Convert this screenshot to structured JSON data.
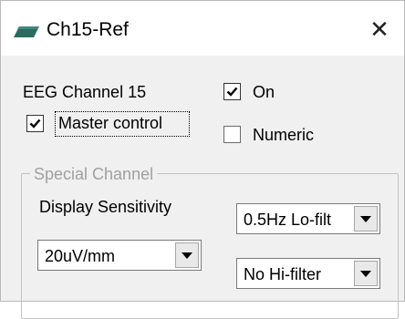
{
  "window": {
    "title": "Ch15-Ref",
    "close_glyph": "✕",
    "icon": "eeg-device-icon"
  },
  "main": {
    "channel_label": "EEG Channel 15",
    "on_checkbox": {
      "label": "On",
      "checked": true
    },
    "master_control_checkbox": {
      "label": "Master control",
      "checked": true
    },
    "numeric_checkbox": {
      "label": "Numeric",
      "checked": false
    }
  },
  "special_channel": {
    "group_title": "Special Channel",
    "display_sensitivity_label": "Display Sensitivity",
    "sensitivity_select": {
      "value": "20uV/mm"
    },
    "lofilter_select": {
      "value": "0.5Hz Lo-filt"
    },
    "hifilter_select": {
      "value": "No Hi-filter"
    }
  },
  "colors": {
    "window_bg": "#f0f0f0",
    "titlebar_bg": "#ffffff",
    "icon_color": "#2b6b5f",
    "group_title_color": "#a0a0a0"
  }
}
